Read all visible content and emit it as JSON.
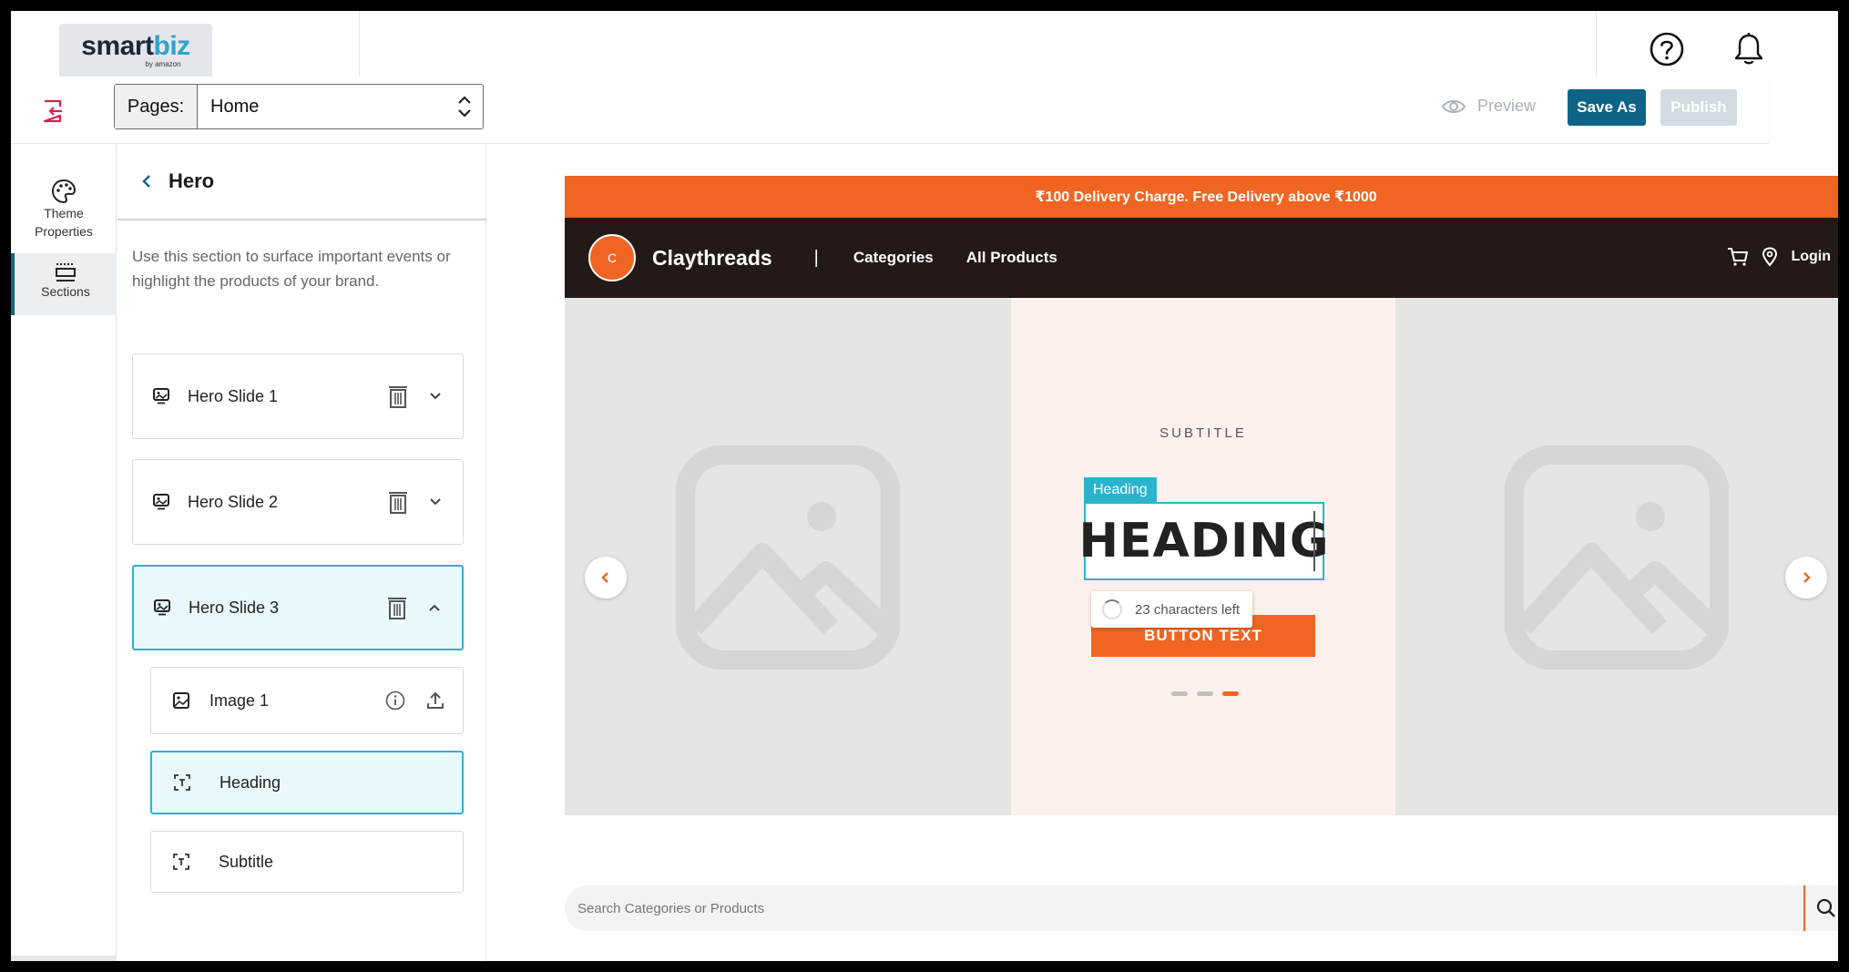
{
  "app": {
    "logo_main": "smart",
    "logo_accent": "biz",
    "logo_sub": "by amazon"
  },
  "toolbar": {
    "pages_label": "Pages:",
    "pages_value": "Home",
    "preview_label": "Preview",
    "save_as_label": "Save As",
    "publish_label": "Publish"
  },
  "rail": {
    "theme_label_1": "Theme",
    "theme_label_2": "Properties",
    "sections_label": "Sections"
  },
  "panel": {
    "title": "Hero",
    "description": "Use this section to surface important events or highlight the products of your brand.",
    "slides": [
      {
        "label": "Hero Slide 1",
        "expanded": false
      },
      {
        "label": "Hero Slide 2",
        "expanded": false
      },
      {
        "label": "Hero Slide 3",
        "expanded": true
      }
    ],
    "slide3_children": [
      {
        "label": "Image 1",
        "icon": "image-icon"
      },
      {
        "label": "Heading",
        "icon": "text-focus-icon",
        "selected": true
      },
      {
        "label": "Subtitle",
        "icon": "text-focus-icon"
      }
    ]
  },
  "store": {
    "announcement": "₹100 Delivery Charge. Free Delivery above ₹1000",
    "logo_letter": "C",
    "name": "Claythreads",
    "separator": "|",
    "nav": [
      "Categories",
      "All Products"
    ],
    "login_label": "Login",
    "hero": {
      "subtitle": "SUBTITLE",
      "heading_tag": "Heading",
      "heading": "HEADING",
      "chars_left": "23 characters left",
      "button_text": "BUTTON TEXT",
      "active_dot": 3,
      "dot_count": 3
    },
    "search_placeholder": "Search Categories or Products"
  },
  "colors": {
    "primary": "#0e6386",
    "accent": "#2bb4cc",
    "brand_orange": "#f06522",
    "nav_dark": "#231a17"
  }
}
